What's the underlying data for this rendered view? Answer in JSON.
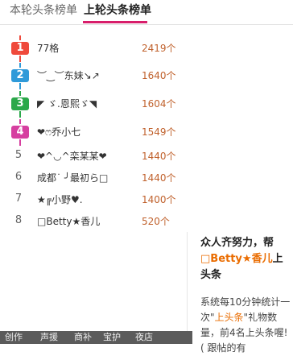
{
  "tabs": [
    {
      "label": "本轮头条榜单"
    },
    {
      "label": "上轮头条榜单"
    }
  ],
  "ranking": [
    {
      "rank": "1",
      "name": "77格",
      "count": "2419个",
      "color": "#ef4a3c"
    },
    {
      "rank": "2",
      "name": "︶‿︶东妹↘↗",
      "count": "1640个",
      "color": "#2f9ad9"
    },
    {
      "rank": "3",
      "name": "◤ ゞ.恩熙ゞ◥",
      "count": "1604个",
      "color": "#2ba84a"
    },
    {
      "rank": "4",
      "name": "❤ෆ乔小七",
      "count": "1549个",
      "color": "#d63fa0"
    },
    {
      "rank": "5",
      "name": "❤^◡^栾某某❤",
      "count": "1440个"
    },
    {
      "rank": "6",
      "name": "成都˙ ╯最初ら□",
      "count": "1440个"
    },
    {
      "rank": "7",
      "name": "★╔小野♥.",
      "count": "1400个"
    },
    {
      "rank": "8",
      "name": "□Betty★香儿",
      "count": "520个"
    }
  ],
  "info": {
    "title_pre": "众人齐努力，帮",
    "title_name": "□Betty★香儿",
    "title_post": "上头条",
    "body_pre": "系统每10分钟统计一次\"",
    "body_hl": "上头条",
    "body_post": "\"礼物数量，前4名上头条喔! ( 跟帖的有"
  },
  "bottom_bar": [
    {
      "label": "创作"
    },
    {
      "label": "声援"
    },
    {
      "label": "商补"
    },
    {
      "label": "宝护"
    },
    {
      "label": "夜店"
    }
  ]
}
